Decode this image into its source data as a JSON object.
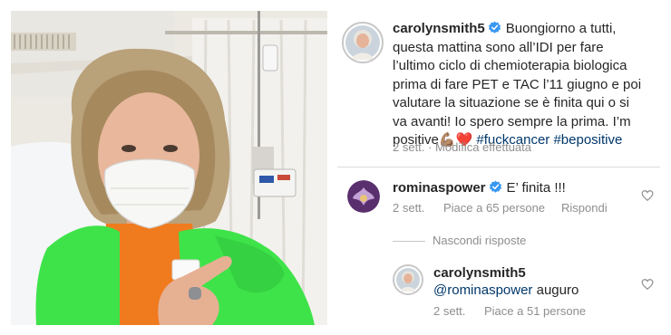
{
  "photo": {
    "alt": ""
  },
  "caption": {
    "username": "carolynsmith5",
    "lines": [
      "Buongiorno a tutti,",
      "questa mattina sono all’IDI per fare",
      "l’ultimo ciclo di chemioterapia biologica",
      "prima di fare PET e TAC l’11 giugno e poi",
      "valutare la situazione se è finita qui o si",
      "va avanti! Io spero sempre la prima. I’m"
    ],
    "last_line_text": "positive",
    "emoji_muscle": "💪🏽",
    "emoji_heart": "❤️",
    "hashtag1": "#fuckcancer",
    "hashtag2": "#bepositive",
    "time": "2 sett.",
    "separator": "·",
    "edited": "Modifica effettuata"
  },
  "comment1": {
    "username": "rominaspower",
    "text": "E’ finita !!!",
    "time": "2 sett.",
    "likes": "Piace a 65 persone",
    "reply": "Rispondi"
  },
  "hide_replies": "Nascondi risposte",
  "reply1": {
    "username": "carolynsmith5",
    "mention": "@rominaspower",
    "text": "auguro",
    "time": "2 sett.",
    "likes": "Piace a 51 persone"
  },
  "colors": {
    "accent_blue": "#3897f0",
    "hashtag": "#00376b",
    "muted": "#8e8e8e",
    "cardigan": "#3ee34a",
    "shirt": "#f07a1e"
  }
}
